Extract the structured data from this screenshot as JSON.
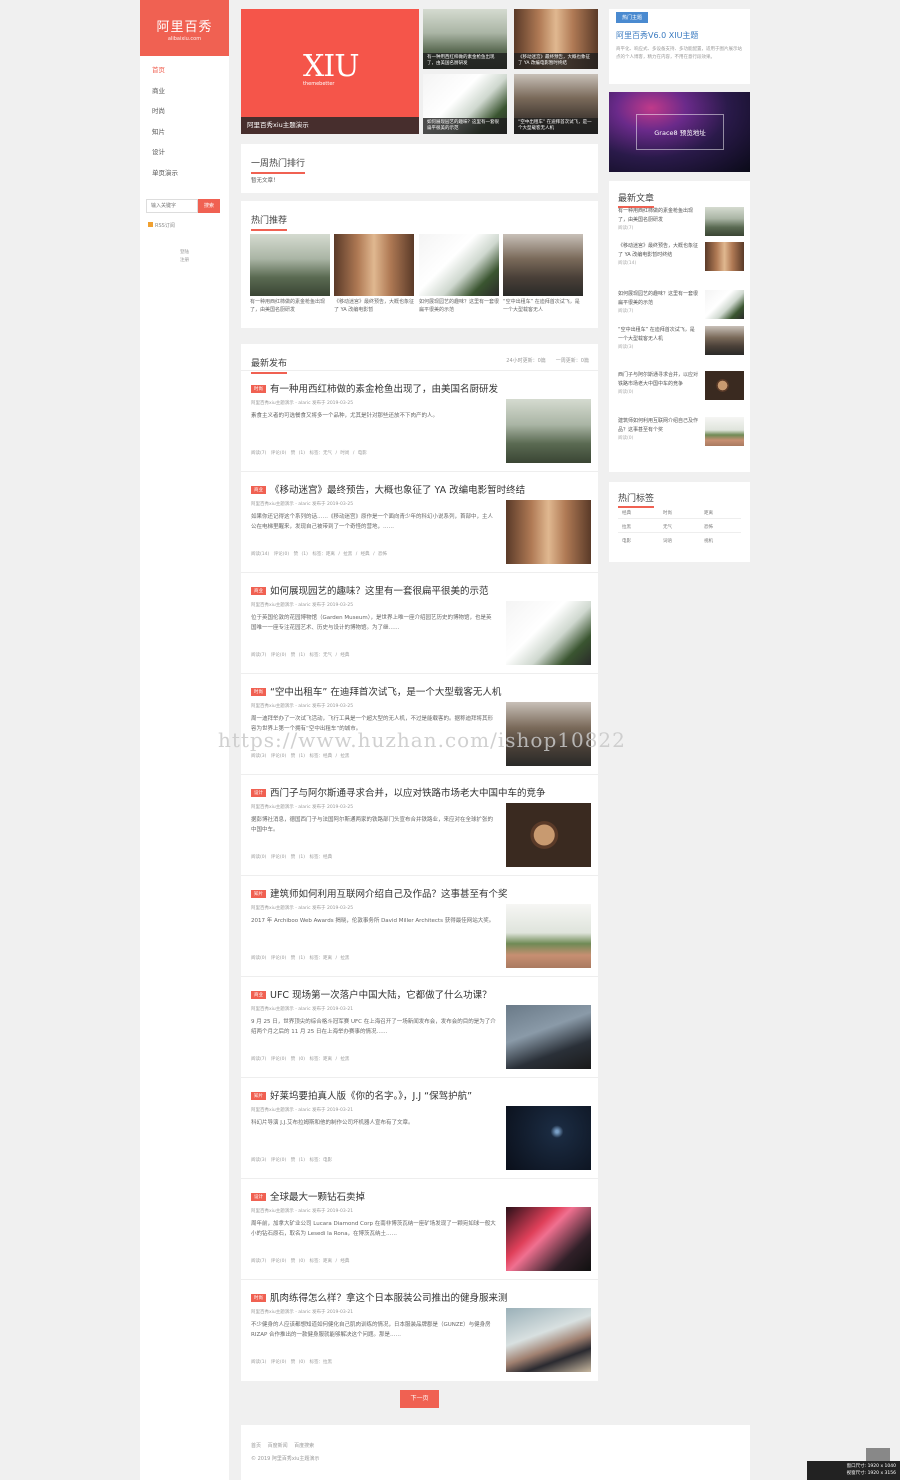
{
  "sidebar": {
    "logo_title": "阿里百秀",
    "logo_sub": "alibaixiu.com",
    "nav": [
      "首页",
      "商业",
      "时尚",
      "知片",
      "设计",
      "单页演示"
    ],
    "search_placeholder": "输入关键字",
    "search_btn": "搜索",
    "rss": "RSS订阅",
    "login": "登陆",
    "register": "注册"
  },
  "focus": {
    "big_logo": "XIU",
    "big_sub": "themebetter",
    "big_caption": "阿里百秀xiu主题演示",
    "items": [
      "有一种用西红柿做的素金枪鱼出现了，由美国名厨研发",
      "《移动迷宫》最终预告，大概也象征了 YA 改编电影暂时终结",
      "如何展现园艺的趣味？这里有一套很扁平很美的示范",
      "“空中出租车” 在迪拜首次试飞，是一个大型载客无人机"
    ]
  },
  "week": {
    "title": "一周热门排行",
    "empty": "暂无文章！"
  },
  "hot": {
    "title": "热门推荐",
    "items": [
      "有一种用西红柿做的素金枪鱼出现了，由美国名厨研发",
      "《移动迷宫》最终预告，大概也象征了 YA 改编电影暂",
      "如何展现园艺的趣味？这里有一套很扁平很美的示范",
      "“空中出租车” 在迪拜首次试飞，是一个大型载客无人"
    ]
  },
  "newest": {
    "title": "最新发布",
    "ext": "24小时更新：0篇　　一周更新：0篇",
    "articles": [
      {
        "tag": "时尚",
        "title": "有一种用西红柿做的素金枪鱼出现了，由美国名厨研发",
        "meta": "阿里百秀xiu主题演示 - alaric 发布于 2019-03-25",
        "excerpt": "素食主义者的可选餐食又将多一个品种，尤其是针对那些还放不下肉产的人。",
        "bottom": "阅读(7)　评论(0)　赞 (1)　标签：无气 / 时尚 / 电影"
      },
      {
        "tag": "商业",
        "title": "《移动迷宫》最终预告，大概也象征了 YA 改编电影暂时终结",
        "meta": "阿里百秀xiu主题演示 - alaric 发布于 2019-03-25",
        "excerpt": "如果你还记得这个系列的话……《移动迷宫》原作是一个面向青少年的科幻小说系列，首部中，主人公在电梯里醒来，发现自己被带到了一个奇怪的营地，……",
        "bottom": "阅读(14)　评论(0)　赞 (1)　标签：距离 / 拉黑 / 经典 / 恐怖"
      },
      {
        "tag": "商业",
        "title": "如何展现园艺的趣味？这里有一套很扁平很美的示范",
        "meta": "阿里百秀xiu主题演示 - alaric 发布于 2019-03-25",
        "excerpt": "位于英国伦敦的花园博物馆（Garden Museum），是世界上唯一座介绍园艺历史的博物馆，也是英国唯一一座专注花园艺术、历史与设计的博物馆。为了继……",
        "bottom": "阅读(7)　评论(0)　赞 (1)　标签：无气 / 经典"
      },
      {
        "tag": "时尚",
        "title": "“空中出租车” 在迪拜首次试飞，是一个大型载客无人机",
        "meta": "阿里百秀xiu主题演示 - alaric 发布于 2019-03-25",
        "excerpt": "周一迪拜举办了一次试飞活动，飞行工具是一个超大型的无人机，不过是能载客的。据称迪拜将其形容为世界上第一个拥有“空中出租车”的城市。",
        "bottom": "阅读(3)　评论(0)　赞 (1)　标签：经典 / 拉黑"
      },
      {
        "tag": "设计",
        "title": "西门子与阿尔斯通寻求合并，以应对铁路市场老大中国中车的竞争",
        "meta": "阿里百秀xiu主题演示 - alaric 发布于 2019-03-25",
        "excerpt": "据彭博社消息，德国西门子与法国阿尔斯通两家的铁路部门头宣布合并铁路业，来应对在全球扩张的中国中车。",
        "bottom": "阅读(0)　评论(0)　赞 (1)　标签：经典"
      },
      {
        "tag": "知片",
        "title": "建筑师如何利用互联网介绍自己及作品？这事甚至有个奖",
        "meta": "阿里百秀xiu主题演示 - alaric 发布于 2019-03-25",
        "excerpt": "2017 年 Archiboo Web Awards 揭晓，伦敦事务所 David Miller Architects 获得最佳网站大奖。",
        "bottom": "阅读(0)　评论(0)　赞 (1)　标签：距离 / 拉黑"
      },
      {
        "tag": "商业",
        "title": "UFC 现场第一次落户中国大陆，它都做了什么功课？",
        "meta": "阿里百秀xiu主题演示 - alaric 发布于 2019-03-21",
        "excerpt": "9 月 25 日，世界顶尖的综合格斗冠军赛 UFC 在上海召开了一场新闻发布会，发布会的目的是为了介绍两个月之后的 11 月 25 日在上海举办赛事的情况……",
        "bottom": "阅读(7)　评论(0)　赞 (0)　标签：距离 / 拉黑"
      },
      {
        "tag": "知片",
        "title": "好莱坞要拍真人版《你的名字。》，J.J “保驾护航”",
        "meta": "阿里百秀xiu主题演示 - alaric 发布于 2019-03-21",
        "excerpt": "科幻片导演 J.J.艾布拉姆斯和他的制作公司坏机器人宣布有了文章。",
        "bottom": "阅读(3)　评论(0)　赞 (1)　标签：电影"
      },
      {
        "tag": "设计",
        "title": "全球最大一颗钻石卖掉",
        "meta": "阿里百秀xiu主题演示 - alaric 发布于 2019-03-21",
        "excerpt": "周年前，加拿大矿业公司 Lucara Diamond Corp 在南非博茨瓦纳一座矿场发现了一颗宛如球一般大小的钻石原石，取名为 Lesedi la Rona，在博茨瓦纳土……",
        "bottom": "阅读(7)　评论(0)　赞 (0)　标签：距离 / 经典"
      },
      {
        "tag": "时尚",
        "title": "肌肉练得怎么样？拿这个日本服装公司推出的健身服来测",
        "meta": "阿里百秀xiu主题演示 - alaric 发布于 2019-03-21",
        "excerpt": "不少健身的人应该都想知道如何健化自己肌肉训练的情况，日本服装品牌郡是（GUNZE）与健身房 RIZAP 合作推出的一款健身服就能够解决这个问题。那是……",
        "bottom": "阅读(1)　评论(0)　赞 (0)　标签：拉黑"
      }
    ]
  },
  "pager": "下一页",
  "footer": {
    "links": "首页 　百度新闻 　百度搜索",
    "copy": "© 2019 阿里百秀xiu主题演示"
  },
  "right": {
    "sticky_label": "热门主题",
    "sticky_title": "阿里百秀V6.0 XIU主题",
    "sticky_desc": "商平化、响应式、多设备支持、多功能配置，适用于图片展示站点的个人博客，精力在内容，不用在意行段效果。",
    "banner": "Grace8 预览地址",
    "latest_title": "最新文章",
    "latest": [
      {
        "t": "有一种用西红柿做的素金枪鱼出现了，由美国名厨研发",
        "d": "阅读(7)"
      },
      {
        "t": "《移动迷宫》最终预告，大概也象征了 YA 改编电影暂时终结",
        "d": "阅读(14)"
      },
      {
        "t": "如何展现园艺的趣味？这里有一套很扁平很美的示范",
        "d": "阅读(7)"
      },
      {
        "t": "“空中出租车” 在迪拜首次试飞，是一个大型载客无人机",
        "d": "阅读(3)"
      },
      {
        "t": "西门子与阿尔斯通寻求合并，以应对铁路市场老大中国中车的竞争",
        "d": "阅读(0)"
      },
      {
        "t": "建筑师如何利用互联网介绍自己及作品？这事甚至有个奖",
        "d": "阅读(0)"
      }
    ],
    "tags_title": "热门标签",
    "tags": [
      "经典",
      "时尚",
      "距离",
      "拉黑",
      "无气",
      "恐怖",
      "电影",
      "词语",
      "视机"
    ]
  },
  "watermark": "https://www.huzhan.com/ishop10822",
  "window_info": [
    "窗口尺寸: 1920 x 1040",
    "视窗尺寸: 1920 x 3156"
  ]
}
